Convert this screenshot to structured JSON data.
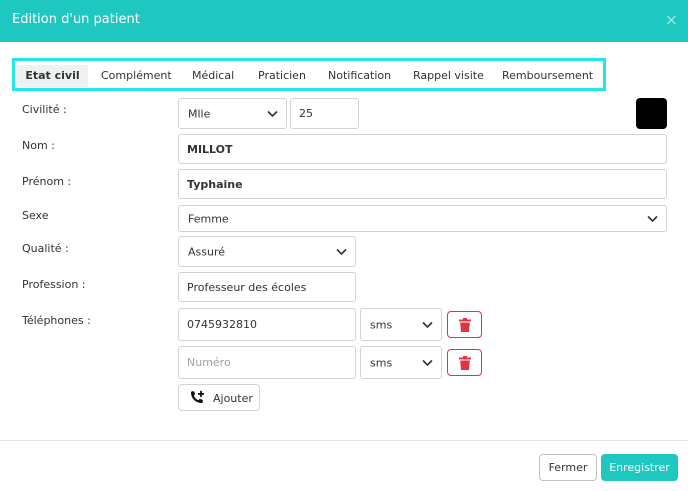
{
  "modal": {
    "title": "Edition d'un patient",
    "close_icon": "×"
  },
  "tabs": [
    {
      "label": "Etat civil",
      "active": true
    },
    {
      "label": "Complément"
    },
    {
      "label": "Médical"
    },
    {
      "label": "Praticien"
    },
    {
      "label": "Notification"
    },
    {
      "label": "Rappel visite"
    },
    {
      "label": "Remboursement"
    }
  ],
  "form": {
    "civilite": {
      "label": "Civilité :",
      "title_value": "Mlle",
      "number_value": "25",
      "color_swatch": "#000000"
    },
    "nom": {
      "label": "Nom :",
      "value": "MILLOT"
    },
    "prenom": {
      "label": "Prénom :",
      "value": "Typhaine"
    },
    "sexe": {
      "label": "Sexe",
      "value": "Femme"
    },
    "qualite": {
      "label": "Qualité :",
      "value": "Assuré"
    },
    "profession": {
      "label": "Profession :",
      "value": "Professeur des écoles"
    },
    "telephones": {
      "label": "Téléphones :",
      "rows": [
        {
          "value": "0745932810",
          "placeholder": "Numéro",
          "type": "sms"
        },
        {
          "value": "",
          "placeholder": "Numéro",
          "type": "sms"
        }
      ],
      "add_label": "Ajouter",
      "add_icon": "phone-plus-icon",
      "delete_icon": "trash-icon"
    }
  },
  "footer": {
    "close_label": "Fermer",
    "save_label": "Enregistrer"
  },
  "colors": {
    "brand": "#1ec8c0",
    "danger": "#dc3545",
    "tab_highlight": "#22e8ec"
  }
}
